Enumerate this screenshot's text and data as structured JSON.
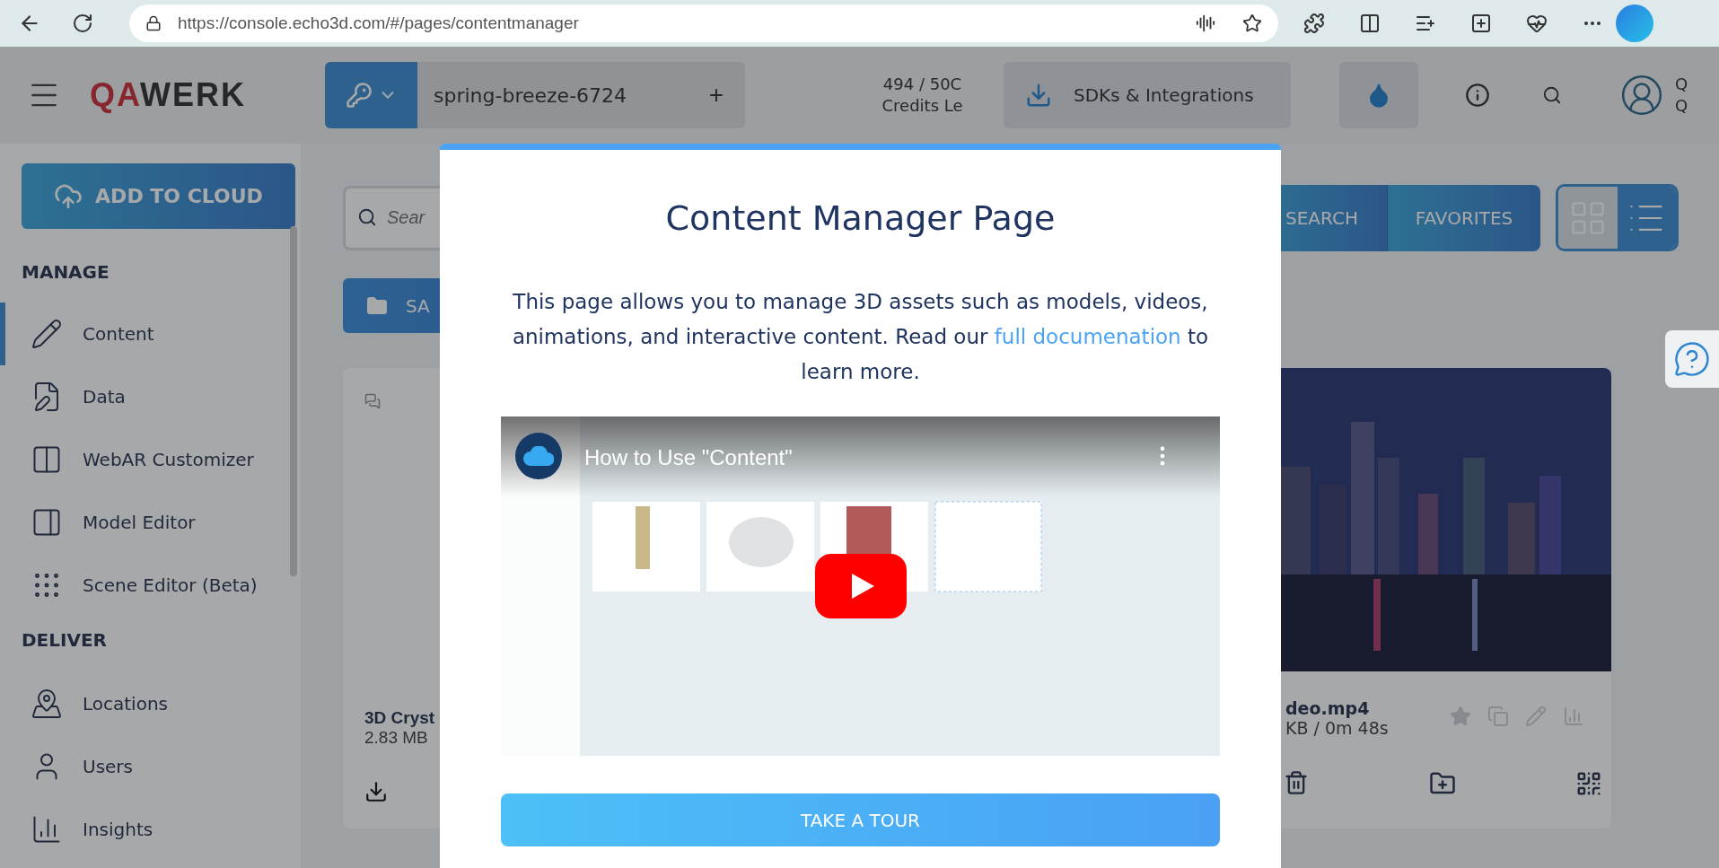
{
  "browser": {
    "url": "https://console.echo3d.com/#/pages/contentmanager"
  },
  "header": {
    "logo_accent": "QA",
    "logo_rest": "WERK",
    "project": "spring-breeze-6724",
    "project_add": "+",
    "credits": [
      "494 / 50C",
      "Credits Le"
    ],
    "sdk_button": "SDKs & Integrations",
    "avatar_letters": [
      "Q",
      "Q"
    ]
  },
  "sidebar": {
    "add_button": "ADD TO CLOUD",
    "sections": [
      {
        "title": "MANAGE",
        "items": [
          {
            "label": "Content",
            "selected": true
          },
          {
            "label": "Data",
            "selected": false
          },
          {
            "label": "WebAR Customizer",
            "selected": false
          },
          {
            "label": "Model Editor",
            "selected": false
          },
          {
            "label": "Scene Editor (Beta)",
            "selected": false
          }
        ]
      },
      {
        "title": "DELIVER",
        "items": [
          {
            "label": "Locations",
            "selected": false
          },
          {
            "label": "Users",
            "selected": false
          },
          {
            "label": "Insights",
            "selected": false
          }
        ]
      }
    ]
  },
  "toolbar": {
    "search_placeholder": "Sear",
    "search_button": "SEARCH",
    "favorites_button": "FAVORITES",
    "views": [
      {
        "kind": "grid",
        "selected": true
      },
      {
        "kind": "list",
        "selected": false
      }
    ],
    "folder_button": "SA"
  },
  "left_card": {
    "name": "3D Cryst",
    "size": "2.83 MB"
  },
  "right_card": {
    "kind": "picture",
    "name": "deo.mp4",
    "size": "KB / 0m 48s"
  },
  "modal": {
    "title": "Content Manager Page",
    "text": "This page allows you to manage 3D assets such as models, videos, animations, and interactive content. Read our",
    "link": "full documenation",
    "text_after": "to learn more.",
    "video_title": "How to Use \"Content\"",
    "button": "TAKE A TOUR"
  }
}
